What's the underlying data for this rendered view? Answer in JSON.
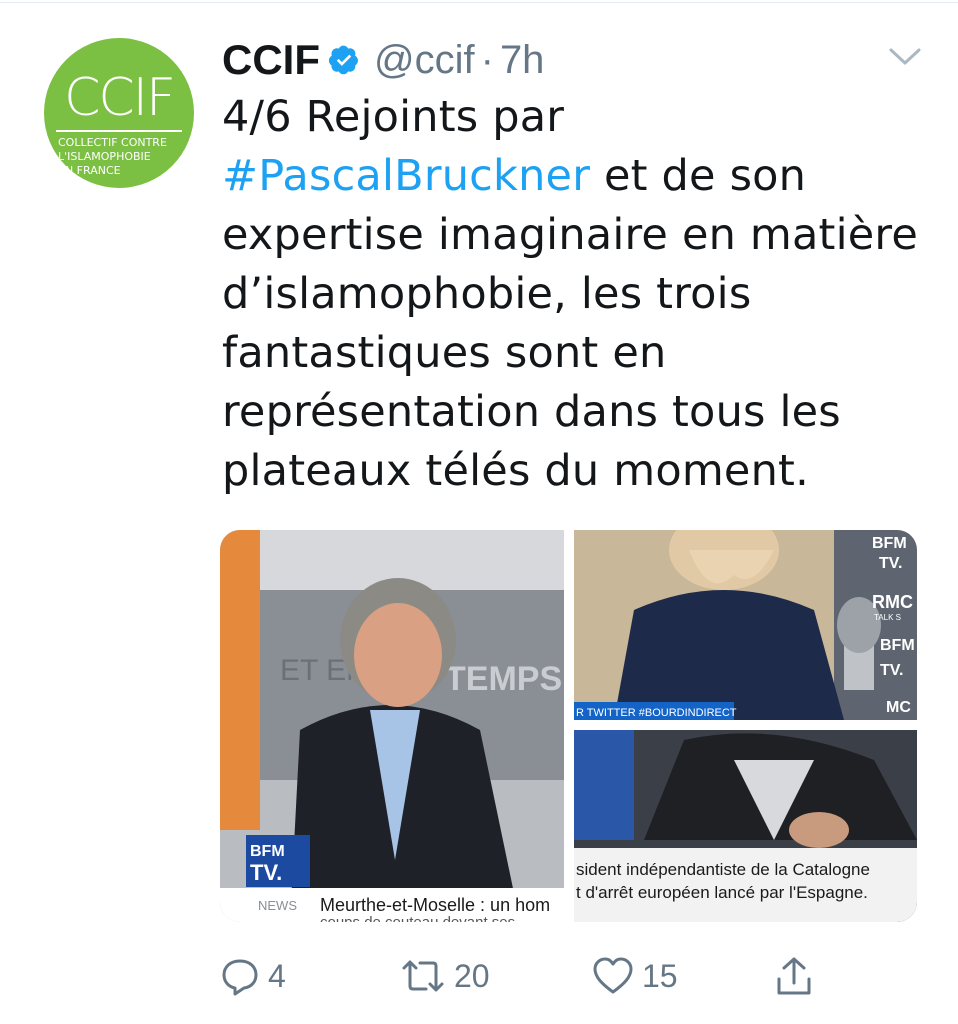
{
  "tweet": {
    "display_name": "CCIF",
    "handle": "@ccif",
    "separator": "·",
    "time": "7h",
    "text_lines": [
      {
        "pre": "4/6 Rejoints par",
        "tag": "",
        "post": ""
      },
      {
        "pre": "",
        "tag": "#PascalBruckner",
        "post": " et de son"
      },
      {
        "pre": "expertise imaginaire en matière",
        "tag": "",
        "post": ""
      },
      {
        "pre": "d’islamophobie, les trois",
        "tag": "",
        "post": ""
      },
      {
        "pre": "fantastiques sont en",
        "tag": "",
        "post": ""
      },
      {
        "pre": "représentation dans tous les",
        "tag": "",
        "post": ""
      },
      {
        "pre": "plateaux télés du moment.",
        "tag": "",
        "post": ""
      }
    ]
  },
  "avatar": {
    "logo_main": "CCIF",
    "logo_sub": [
      "COLLECTIF CONTRE",
      "L'ISLAMOPHOBIE",
      "EN FRANCE"
    ]
  },
  "media": {
    "left": {
      "channel_logo_line1": "BFM",
      "channel_logo_line2": "TV.",
      "backdrop_text": "TEMPS",
      "backdrop_text2": "ET EN",
      "news_label": "NEWS",
      "ticker": "Meurthe-et-Moselle : un hom",
      "ticker2": "coups de couteau devant ses"
    },
    "top_right": {
      "banner": "R TWITTER #BOURDINDIRECT",
      "side_logos": [
        "BFM",
        "TV.",
        "RMC",
        "TALK S",
        "BFM",
        "TV.",
        "MC"
      ]
    },
    "bottom_right": {
      "caption1": "sident indépendantiste de la Catalogne",
      "caption2": "t d'arrêt européen lancé par l'Espagne."
    }
  },
  "actions": {
    "reply_count": "4",
    "retweet_count": "20",
    "like_count": "15"
  },
  "icons": {
    "verified": "verified-badge-icon",
    "chevron": "chevron-down-icon",
    "reply": "reply-icon",
    "retweet": "retweet-icon",
    "like": "heart-icon",
    "share": "share-icon"
  },
  "colors": {
    "link": "#1da1f2",
    "muted": "#657786",
    "avatar_green": "#7bc043"
  }
}
